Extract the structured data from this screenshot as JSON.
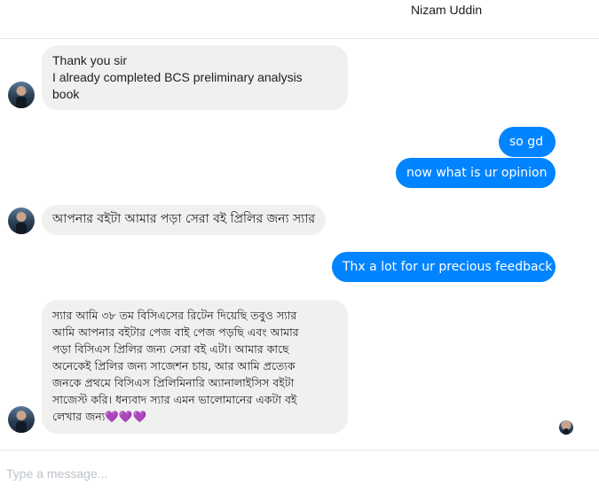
{
  "header": {
    "contact_name": "Nizam Uddin"
  },
  "messages": [
    {
      "direction": "in",
      "lines": [
        "Thank you sir",
        "I already completed BCS preliminary analysis",
        "book"
      ]
    },
    {
      "direction": "out",
      "text": "so gd"
    },
    {
      "direction": "out",
      "text": "now what is ur opinion"
    },
    {
      "direction": "in",
      "lines": [
        "আপনার বইটা আমার পড়া সেরা বই প্রিলির জন্য স্যার"
      ]
    },
    {
      "direction": "out",
      "text": "Thx a lot for ur precious feedback"
    },
    {
      "direction": "in",
      "lines": [
        "স্যার আমি ৩৮ তম বিসিএসের রিটেন দিয়েছি তবুও  স্যার",
        "আমি আপনার বইটার পেজ বাই পেজ পড়ছি এবং আমার",
        "পড়া বিসিএস প্রিলির জন্য সেরা বই এটা। আমার কাছে",
        "অনেকেই প্রিলির জন্য সাজেশন চায়,  আর আমি প্রত্যেক",
        "জনকে প্রথমে বিসিএস প্রিলিমিনারি অ্যানালাইসিস বইটা",
        "সাজেস্ট করি।  ধন্যবাদ স্যার এমন ভালোমানের একটা বই",
        "লেখার জন্য💜💜💜"
      ]
    }
  ],
  "composer": {
    "placeholder": "Type a message..."
  },
  "icons": {
    "avatar": "contact-avatar-icon",
    "read_receipt": "seen-avatar-icon"
  }
}
